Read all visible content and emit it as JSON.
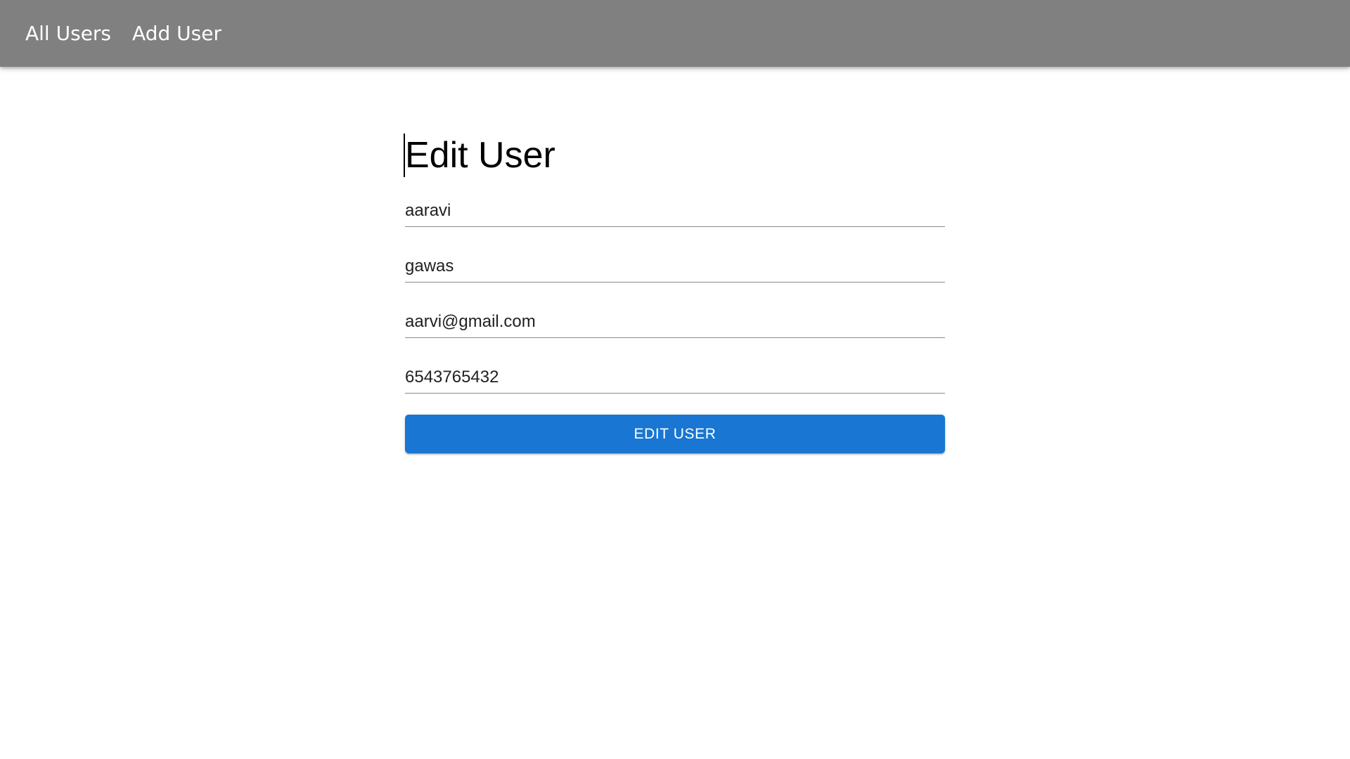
{
  "nav": {
    "links": [
      {
        "label": "All Users"
      },
      {
        "label": "Add User"
      }
    ],
    "bar_color": "#808080"
  },
  "form": {
    "title": "Edit User",
    "fields": {
      "first_name": "aaravi",
      "last_name": "gawas",
      "email": "aarvi@gmail.com",
      "phone": "6543765432"
    },
    "submit_label": "EDIT USER",
    "accent_color": "#1976d2"
  }
}
